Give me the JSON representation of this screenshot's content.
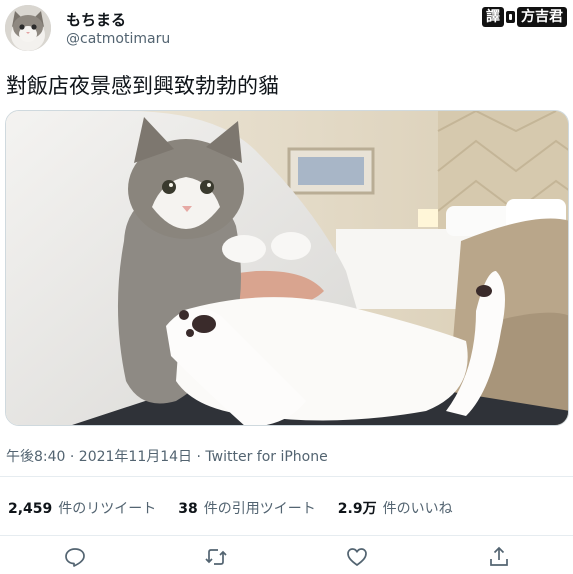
{
  "user": {
    "display_name": "もちまる",
    "handle": "@catmotimaru"
  },
  "watermark": {
    "left_text": "譯",
    "right_text": "方吉君"
  },
  "tweet": {
    "text": "對飯店夜景感到興致勃勃的貓",
    "timestamp": "午後8:40 · 2021年11月14日 · Twitter for iPhone"
  },
  "stats": {
    "retweets_count": "2,459",
    "retweets_label": "件のリツイート",
    "quotes_count": "38",
    "quotes_label": "件の引用ツイート",
    "likes_count": "2.9万",
    "likes_label": "件のいいね"
  },
  "actions": {
    "icons": [
      "reply-icon",
      "retweet-icon",
      "like-icon",
      "share-icon"
    ]
  },
  "colors": {
    "text_primary": "#0f1419",
    "text_secondary": "#536471",
    "icon": "#536471",
    "divider": "#e6ecf0"
  }
}
